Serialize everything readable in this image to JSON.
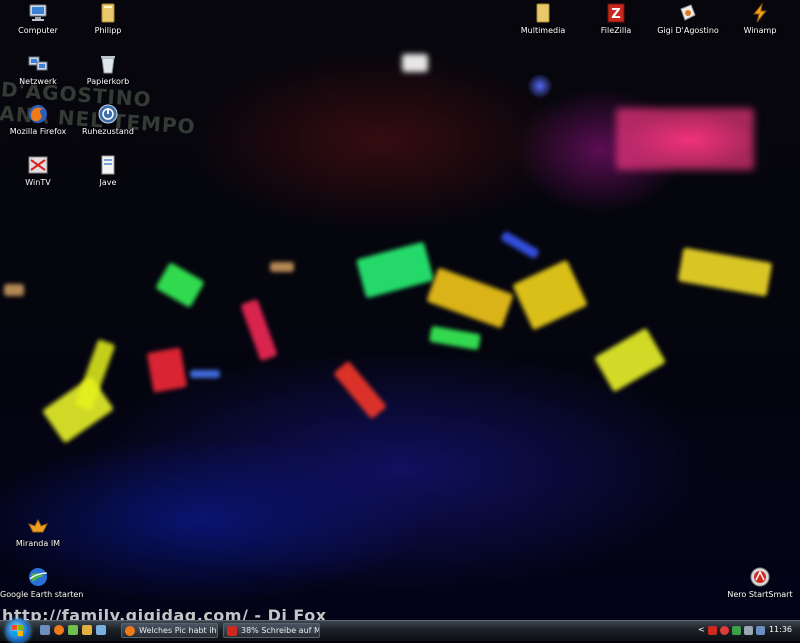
{
  "desktop": {
    "icons": [
      {
        "label": "Computer",
        "icon": "computer-icon"
      },
      {
        "label": "Philipp",
        "icon": "user-folder-icon"
      },
      {
        "label": "Netzwerk",
        "icon": "network-icon"
      },
      {
        "label": "Papierkorb",
        "icon": "recycle-bin-icon"
      },
      {
        "label": "Mozilla Firefox",
        "icon": "firefox-icon"
      },
      {
        "label": "Ruhezustand",
        "icon": "hibernate-icon"
      },
      {
        "label": "WinTV",
        "icon": "wintv-icon"
      },
      {
        "label": "Jave",
        "icon": "jave-icon"
      },
      {
        "label": "Miranda IM",
        "icon": "miranda-icon"
      },
      {
        "label": "Google Earth starten",
        "icon": "google-earth-icon"
      },
      {
        "label": "Multimedia",
        "icon": "folder-icon"
      },
      {
        "label": "FileZilla",
        "icon": "filezilla-icon"
      },
      {
        "label": "Gigi D'Agostino",
        "icon": "music-file-icon"
      },
      {
        "label": "Winamp",
        "icon": "winamp-icon"
      },
      {
        "label": "Nero StartSmart",
        "icon": "nero-icon"
      }
    ]
  },
  "wallpaper": {
    "watermark": "http://family.gigidag.com/ - Dj Fox"
  },
  "taskbar": {
    "tasks": [
      {
        "label": "Welches Pic habt ihr...",
        "icon": "firefox-icon"
      },
      {
        "label": "38% Schreibe auf M...",
        "icon": "nero-burn-icon"
      }
    ],
    "tray_arrow": "<",
    "clock": "11:36"
  },
  "colors": {
    "taskbar": "#1b2026",
    "start_orb": "#1b6fc4",
    "accent_pink": "#ff2878",
    "accent_blue": "#5a6eff"
  }
}
